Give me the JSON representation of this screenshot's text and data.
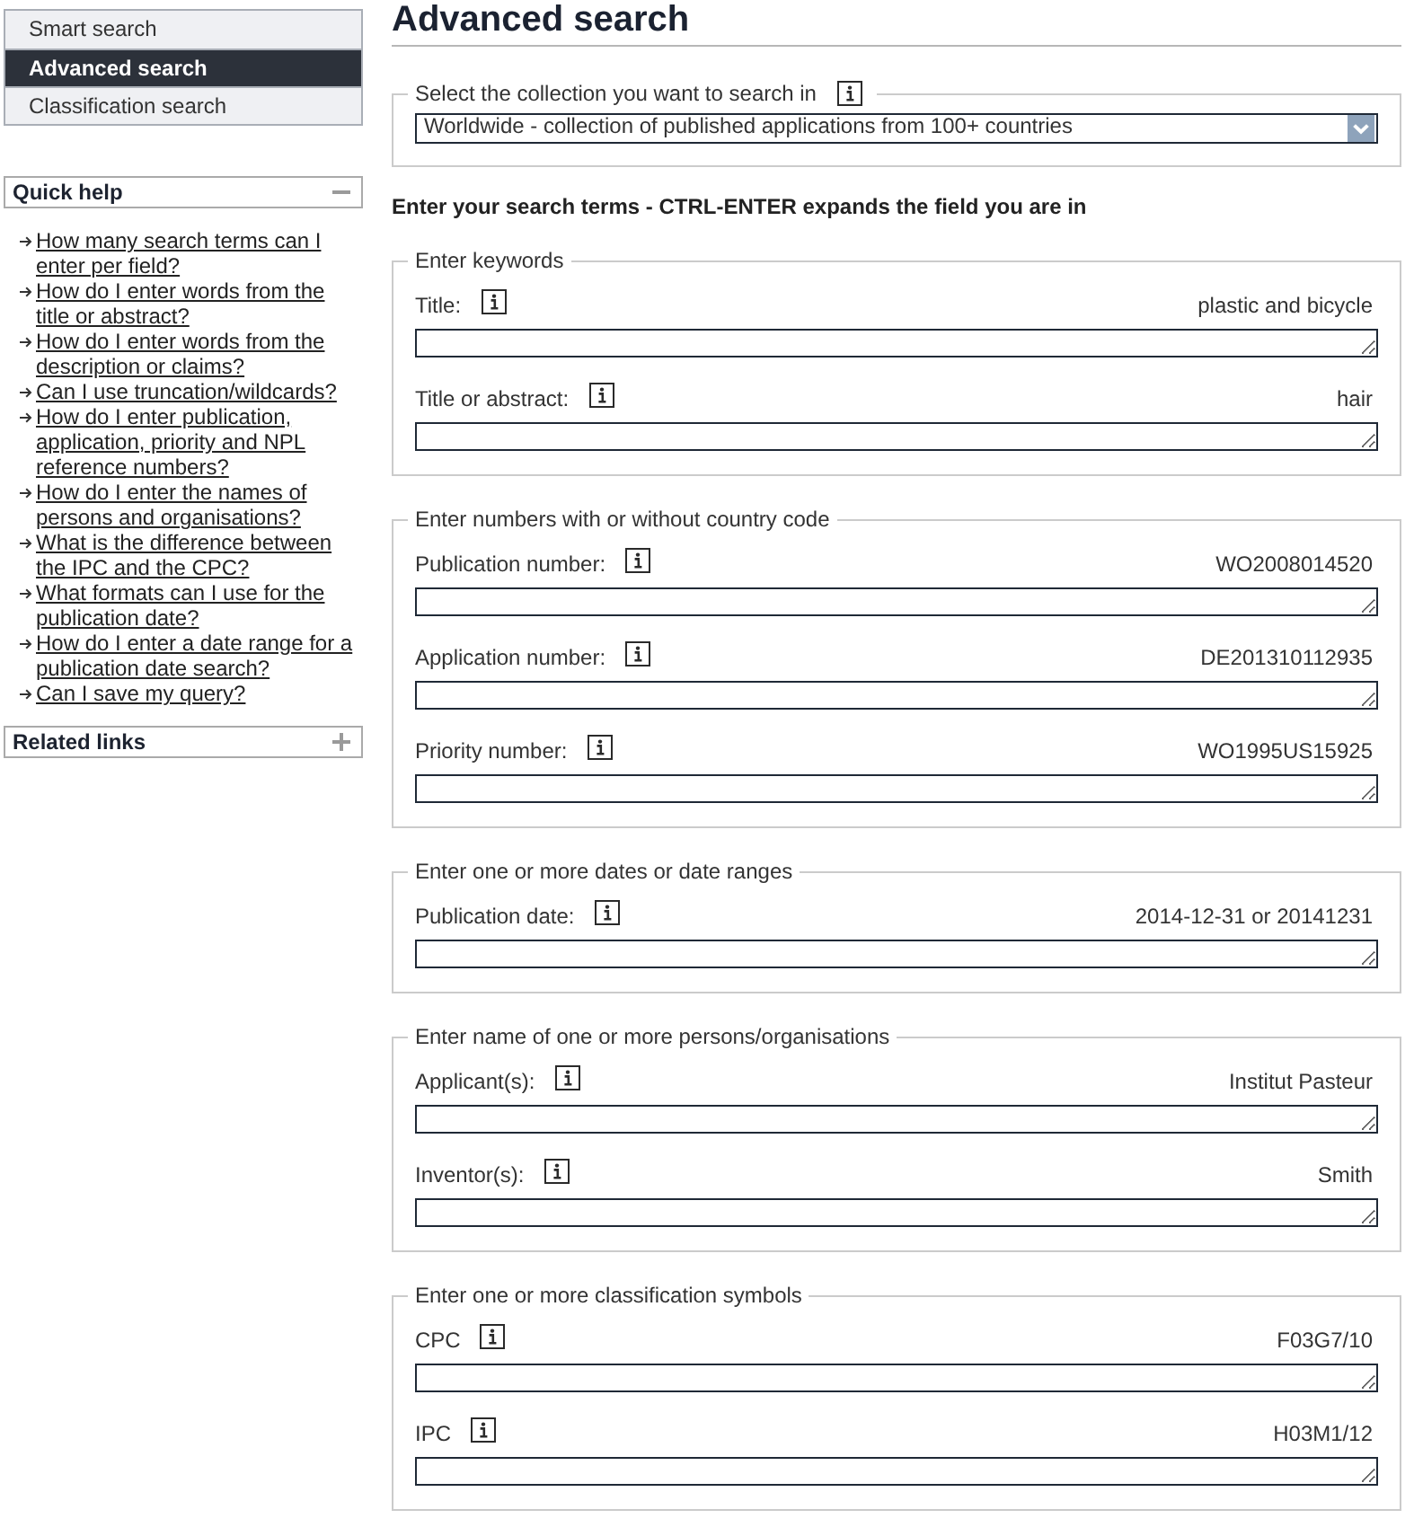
{
  "sidebar": {
    "nav": [
      {
        "label": "Smart search",
        "selected": false
      },
      {
        "label": "Advanced search",
        "selected": true
      },
      {
        "label": "Classification search",
        "selected": false
      }
    ],
    "panels": [
      {
        "title": "Quick help",
        "expanded": true,
        "links": [
          "How many search terms can I enter per field?",
          "How do I enter words from the title or abstract?",
          "How do I enter words from the description or claims?",
          "Can I use truncation/wildcards?",
          "How do I enter publication, application, priority and NPL reference numbers?",
          "How do I enter the names of persons and organisations?",
          "What is the difference between the IPC and the CPC?",
          "What formats can I use for the publication date?",
          "How do I enter a date range for a publication date search?",
          "Can I save my query?"
        ]
      },
      {
        "title": "Related links",
        "expanded": false
      }
    ]
  },
  "main": {
    "title": "Advanced search",
    "collection": {
      "legend": "Select the collection you want to search in",
      "value": "Worldwide - collection of published applications from 100+ countries"
    },
    "instructions": "Enter your search terms - CTRL-ENTER expands the field you are in",
    "fieldsets": [
      {
        "legend": "Enter keywords",
        "fields": [
          {
            "label": "Title:",
            "example": "plastic and bicycle"
          },
          {
            "label": "Title or abstract:",
            "example": "hair"
          }
        ]
      },
      {
        "legend": "Enter numbers with or without country code",
        "fields": [
          {
            "label": "Publication number:",
            "example": "WO2008014520"
          },
          {
            "label": "Application number:",
            "example": "DE201310112935"
          },
          {
            "label": "Priority number:",
            "example": "WO1995US15925"
          }
        ]
      },
      {
        "legend": "Enter one or more dates or date ranges",
        "fields": [
          {
            "label": "Publication date:",
            "example": "2014-12-31 or 20141231"
          }
        ]
      },
      {
        "legend": "Enter name of one or more persons/organisations",
        "fields": [
          {
            "label": "Applicant(s):",
            "example": "Institut Pasteur"
          },
          {
            "label": "Inventor(s):",
            "example": "Smith"
          }
        ]
      },
      {
        "legend": "Enter one or more classification symbols",
        "fields": [
          {
            "label": "CPC",
            "example": "F03G7/10"
          },
          {
            "label": "IPC",
            "example": "H03M1/12"
          }
        ]
      }
    ]
  }
}
